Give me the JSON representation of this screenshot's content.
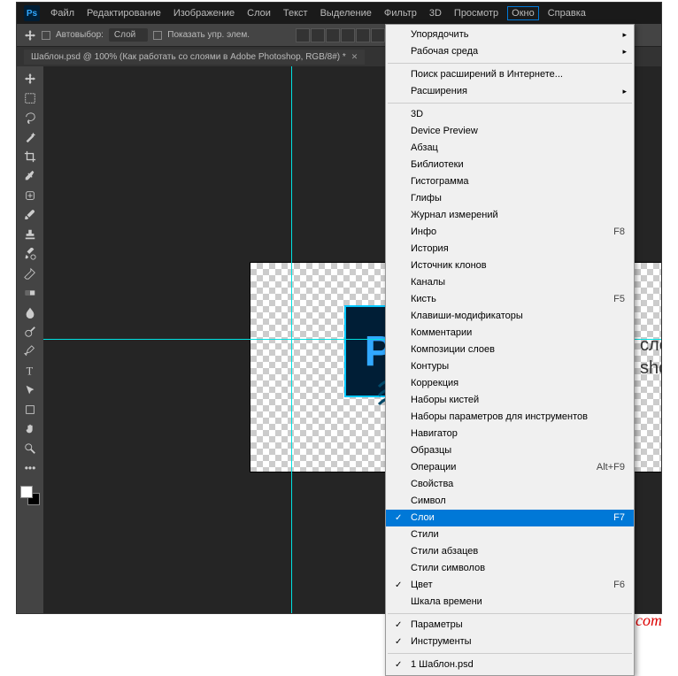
{
  "menubar": {
    "items": [
      "Файл",
      "Редактирование",
      "Изображение",
      "Слои",
      "Текст",
      "Выделение",
      "Фильтр",
      "3D",
      "Просмотр",
      "Окно",
      "Справка"
    ],
    "active_index": 9
  },
  "optbar": {
    "auto_select_label": "Автовыбор:",
    "layer_dropdown": "Слой",
    "show_controls_label": "Показать упр. элем.",
    "more": "•••"
  },
  "tab": {
    "title": "Шаблон.psd @ 100% (Как работать со слоями в Adobe Photoshop, RGB/8#) *"
  },
  "canvas": {
    "ps_label": "Ps",
    "text_line1": "слоями",
    "text_line2": "shop"
  },
  "window_menu": {
    "groups": [
      [
        {
          "label": "Упорядочить",
          "submenu": true
        },
        {
          "label": "Рабочая среда",
          "submenu": true
        }
      ],
      [
        {
          "label": "Поиск расширений в Интернете..."
        },
        {
          "label": "Расширения",
          "submenu": true
        }
      ],
      [
        {
          "label": "3D"
        },
        {
          "label": "Device Preview"
        },
        {
          "label": "Абзац"
        },
        {
          "label": "Библиотеки"
        },
        {
          "label": "Гистограмма"
        },
        {
          "label": "Глифы"
        },
        {
          "label": "Журнал измерений"
        },
        {
          "label": "Инфо",
          "shortcut": "F8"
        },
        {
          "label": "История"
        },
        {
          "label": "Источник клонов"
        },
        {
          "label": "Каналы"
        },
        {
          "label": "Кисть",
          "shortcut": "F5"
        },
        {
          "label": "Клавиши-модификаторы"
        },
        {
          "label": "Комментарии"
        },
        {
          "label": "Композиции слоев"
        },
        {
          "label": "Контуры"
        },
        {
          "label": "Коррекция"
        },
        {
          "label": "Наборы кистей"
        },
        {
          "label": "Наборы параметров для инструментов"
        },
        {
          "label": "Навигатор"
        },
        {
          "label": "Образцы"
        },
        {
          "label": "Операции",
          "shortcut": "Alt+F9"
        },
        {
          "label": "Свойства"
        },
        {
          "label": "Символ"
        },
        {
          "label": "Слои",
          "shortcut": "F7",
          "checked": true,
          "highlight": true
        },
        {
          "label": "Стили"
        },
        {
          "label": "Стили абзацев"
        },
        {
          "label": "Стили символов"
        },
        {
          "label": "Цвет",
          "shortcut": "F6",
          "checked": true
        },
        {
          "label": "Шкала времени"
        }
      ],
      [
        {
          "label": "Параметры",
          "checked": true
        },
        {
          "label": "Инструменты",
          "checked": true
        }
      ],
      [
        {
          "label": "1 Шаблон.psd",
          "checked": true
        }
      ]
    ]
  },
  "watermark": "Public-PC.com"
}
